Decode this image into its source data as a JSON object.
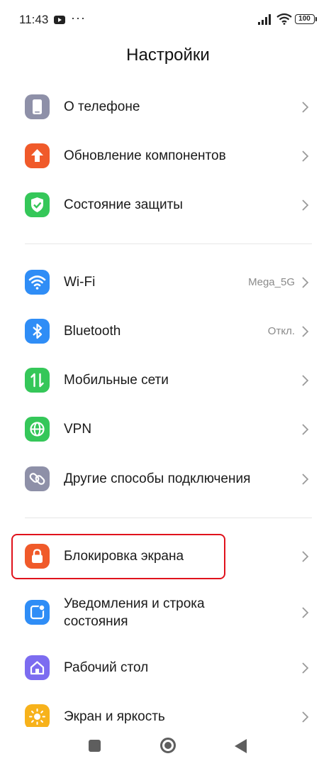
{
  "status_bar": {
    "time": "11:43",
    "more": "···",
    "battery": "100"
  },
  "header": {
    "title": "Настройки"
  },
  "rows": [
    {
      "label": "О телефоне",
      "value": "",
      "icon": "phone-icon",
      "color": "#8e90a8"
    },
    {
      "label": "Обновление компонентов",
      "value": "",
      "icon": "arrow-up-icon",
      "color": "#f05a2a"
    },
    {
      "label": "Состояние защиты",
      "value": "",
      "icon": "shield-check-icon",
      "color": "#35c759"
    },
    {
      "label": "Wi-Fi",
      "value": "Mega_5G",
      "icon": "wifi-icon",
      "color": "#2f8df6"
    },
    {
      "label": "Bluetooth",
      "value": "Откл.",
      "icon": "bluetooth-icon",
      "color": "#2f8df6"
    },
    {
      "label": "Мобильные сети",
      "value": "",
      "icon": "mobile-data-icon",
      "color": "#35c759"
    },
    {
      "label": "VPN",
      "value": "",
      "icon": "globe-icon",
      "color": "#35c759"
    },
    {
      "label": "Другие способы подключения",
      "value": "",
      "icon": "link-icon",
      "color": "#8e90a8"
    },
    {
      "label": "Блокировка экрана",
      "value": "",
      "icon": "lock-icon",
      "color": "#f05a2a"
    },
    {
      "label": "Уведомления и строка состояния",
      "line1": "Уведомления и строка",
      "line2": "состояния",
      "value": "",
      "icon": "notification-icon",
      "color": "#2f8df6"
    },
    {
      "label": "Рабочий стол",
      "value": "",
      "icon": "home-icon",
      "color": "#7c6cf0"
    },
    {
      "label": "Экран и яркость",
      "value": "",
      "icon": "sun-icon",
      "color": "#f7b21b"
    }
  ],
  "colors": {
    "highlight": "#e0121c",
    "chevron": "#9a9a9a",
    "value_text": "#8a8a8a"
  }
}
